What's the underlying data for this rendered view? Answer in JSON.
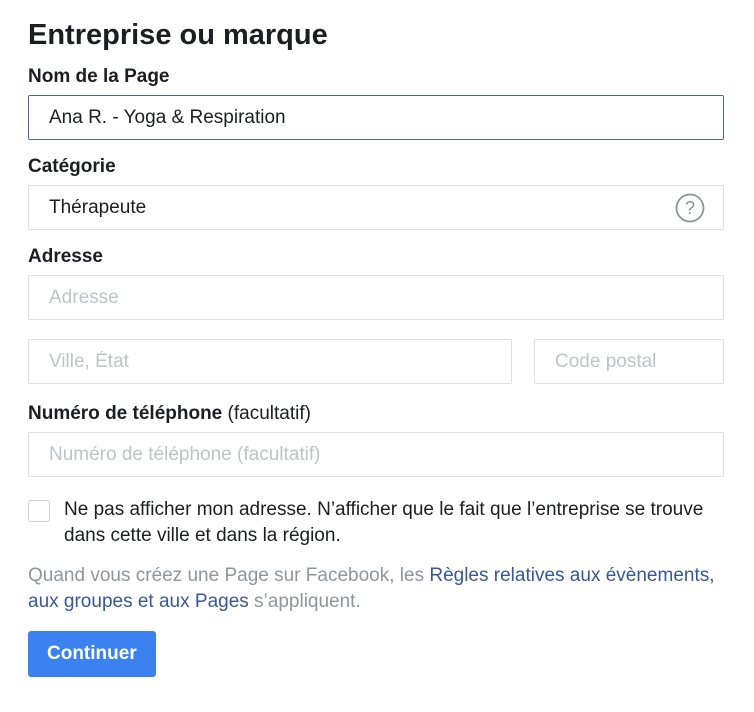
{
  "form": {
    "title": "Entreprise ou marque",
    "page_name": {
      "label": "Nom de la Page",
      "value": "Ana R. - Yoga & Respiration"
    },
    "category": {
      "label": "Catégorie",
      "value": "Thérapeute",
      "help_icon": "question-circle-icon"
    },
    "address": {
      "label": "Adresse",
      "street_placeholder": "Adresse",
      "city_placeholder": "Ville, État",
      "zip_placeholder": "Code postal"
    },
    "phone": {
      "label": "Numéro de téléphone",
      "optional": "(facultatif)",
      "placeholder": "Numéro de téléphone (facultatif)"
    },
    "hide_address": {
      "checked": false,
      "text": "Ne pas afficher mon adresse. N’afficher que le fait que l’entreprise se trouve dans cette ville et dans la région."
    },
    "policy": {
      "prefix": "Quand vous créez une Page sur Facebook, les ",
      "link": "Règles relatives aux évènements, aux groupes et aux Pages",
      "suffix": " s’appliquent."
    },
    "continue_button": "Continuer"
  },
  "colors": {
    "focus_border": "#4267b2",
    "button_bg": "#3b82f0",
    "link": "#365899",
    "muted_text": "#90949c"
  }
}
